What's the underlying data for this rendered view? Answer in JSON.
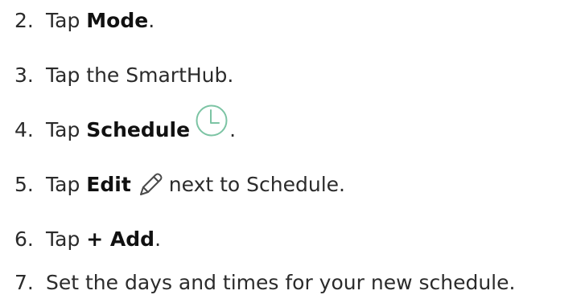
{
  "steps": [
    {
      "number": "2.",
      "pre": "Tap ",
      "bold": "Mode",
      "post": "."
    },
    {
      "number": "3.",
      "text": "Tap the SmartHub."
    },
    {
      "number": "4.",
      "pre": "Tap ",
      "bold": "Schedule",
      "icon": "clock-icon",
      "post": "."
    },
    {
      "number": "5.",
      "pre": "Tap ",
      "bold": "Edit",
      "icon": "pencil-icon",
      "post": "next to Schedule."
    },
    {
      "number": "6.",
      "pre": "Tap ",
      "bold": "+ Add",
      "post": "."
    },
    {
      "number": "7.",
      "text": "Set the days and times for your new schedule."
    }
  ],
  "colors": {
    "text": "#2b2b2b",
    "bold_text": "#111111",
    "clock_icon": "#7cc4a4",
    "pencil_icon": "#4a4a4a"
  }
}
